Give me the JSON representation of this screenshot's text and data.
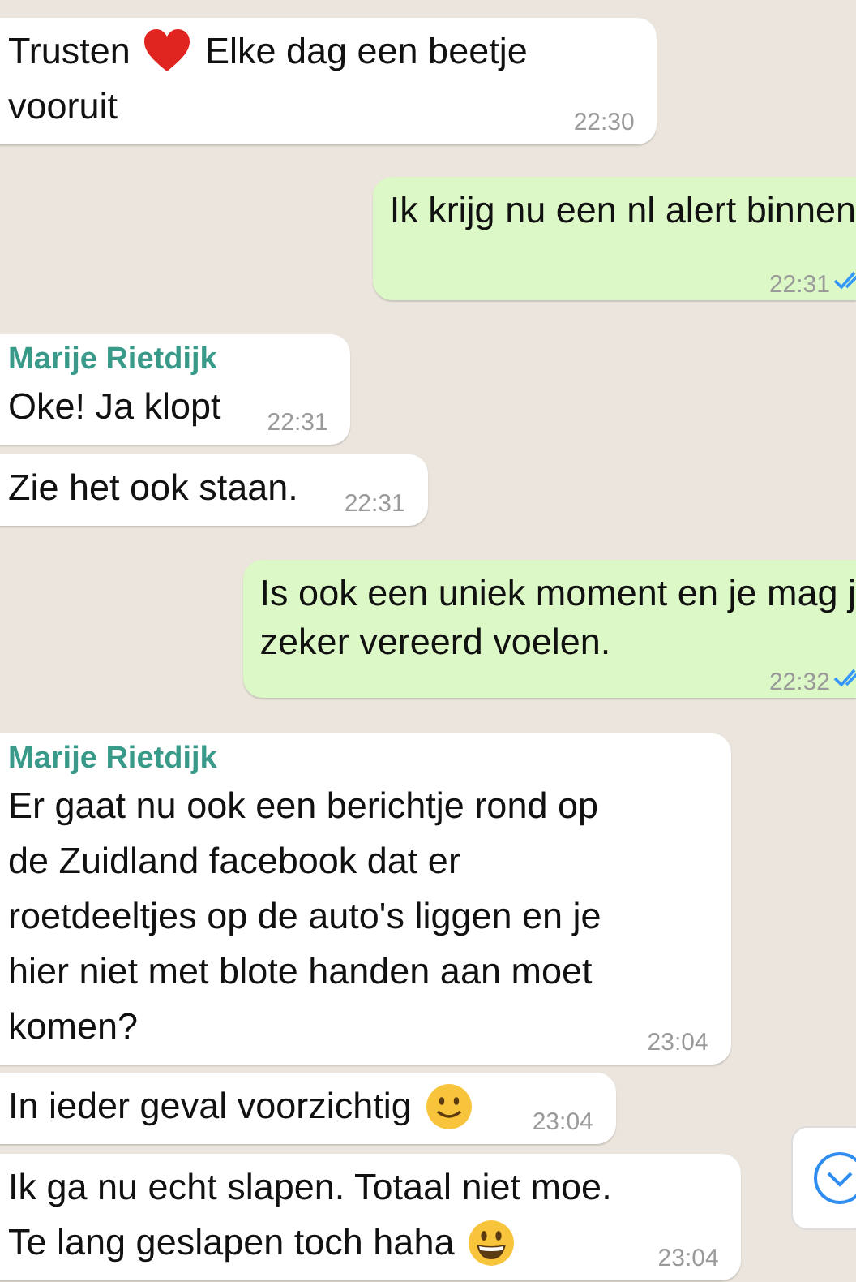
{
  "messages": [
    {
      "kind": "incoming",
      "parts": [
        {
          "kind": "text",
          "text": "Trusten"
        },
        {
          "kind": "heart"
        },
        {
          "kind": "text",
          "text": "Elke dag een beetje"
        },
        {
          "kind": "break"
        },
        {
          "kind": "text",
          "text": "vooruit"
        }
      ],
      "time": "22:30"
    },
    {
      "kind": "outgoing",
      "parts": [
        {
          "kind": "text",
          "text": "Ik krijg nu een nl alert binnen"
        }
      ],
      "time": "22:31",
      "read": true
    },
    {
      "kind": "incoming",
      "sender": "Marije Rietdijk",
      "parts": [
        {
          "kind": "text",
          "text": "Oke! Ja klopt"
        }
      ],
      "time": "22:31"
    },
    {
      "kind": "incoming",
      "parts": [
        {
          "kind": "text",
          "text": "Zie het ook staan."
        }
      ],
      "time": "22:31"
    },
    {
      "kind": "outgoing",
      "parts": [
        {
          "kind": "text",
          "text": "Is ook een uniek moment en je mag j\nzeker vereerd voelen."
        }
      ],
      "time": "22:32",
      "read": true
    },
    {
      "kind": "incoming",
      "sender": "Marije Rietdijk",
      "parts": [
        {
          "kind": "text",
          "text": "Er gaat nu ook een berichtje rond op\nde Zuidland facebook dat er\nroetdeeltjes op de auto's liggen en je\nhier niet met blote handen aan moet\nkomen?"
        }
      ],
      "time": "23:04"
    },
    {
      "kind": "incoming",
      "parts": [
        {
          "kind": "text",
          "text": "In ieder geval voorzichtig"
        },
        {
          "kind": "smile"
        }
      ],
      "time": "23:04"
    },
    {
      "kind": "incoming",
      "parts": [
        {
          "kind": "text",
          "text": "Ik ga nu echt slapen. Totaal niet moe."
        },
        {
          "kind": "break"
        },
        {
          "kind": "text",
          "text": "Te lang geslapen toch haha"
        },
        {
          "kind": "grin"
        }
      ],
      "time": "23:04"
    }
  ],
  "scroll_down_button": true
}
